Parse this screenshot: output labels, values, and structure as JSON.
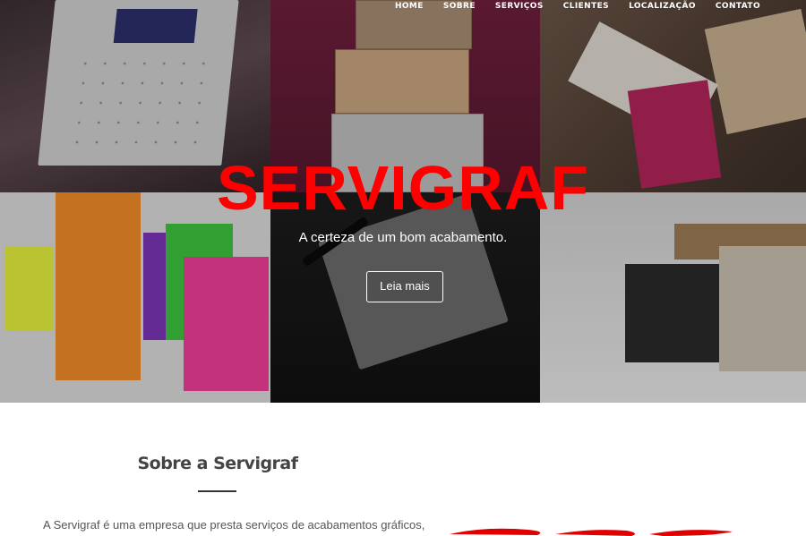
{
  "nav": {
    "items": [
      "HOME",
      "SOBRE",
      "SERVIÇOS",
      "CLIENTES",
      "LOCALIZAÇÃO",
      "CONTATO"
    ]
  },
  "hero": {
    "brand": "SERVIGRAF",
    "tagline": "A certeza de um bom acabamento.",
    "cta_label": "Leia mais"
  },
  "about": {
    "title": "Sobre a Servigraf",
    "text": "A Servigraf é uma empresa que presta serviços de acabamentos gráficos,"
  },
  "colors": {
    "brand_red": "#ff0000",
    "nav_text": "#ffffff",
    "heading_text": "#444444"
  }
}
